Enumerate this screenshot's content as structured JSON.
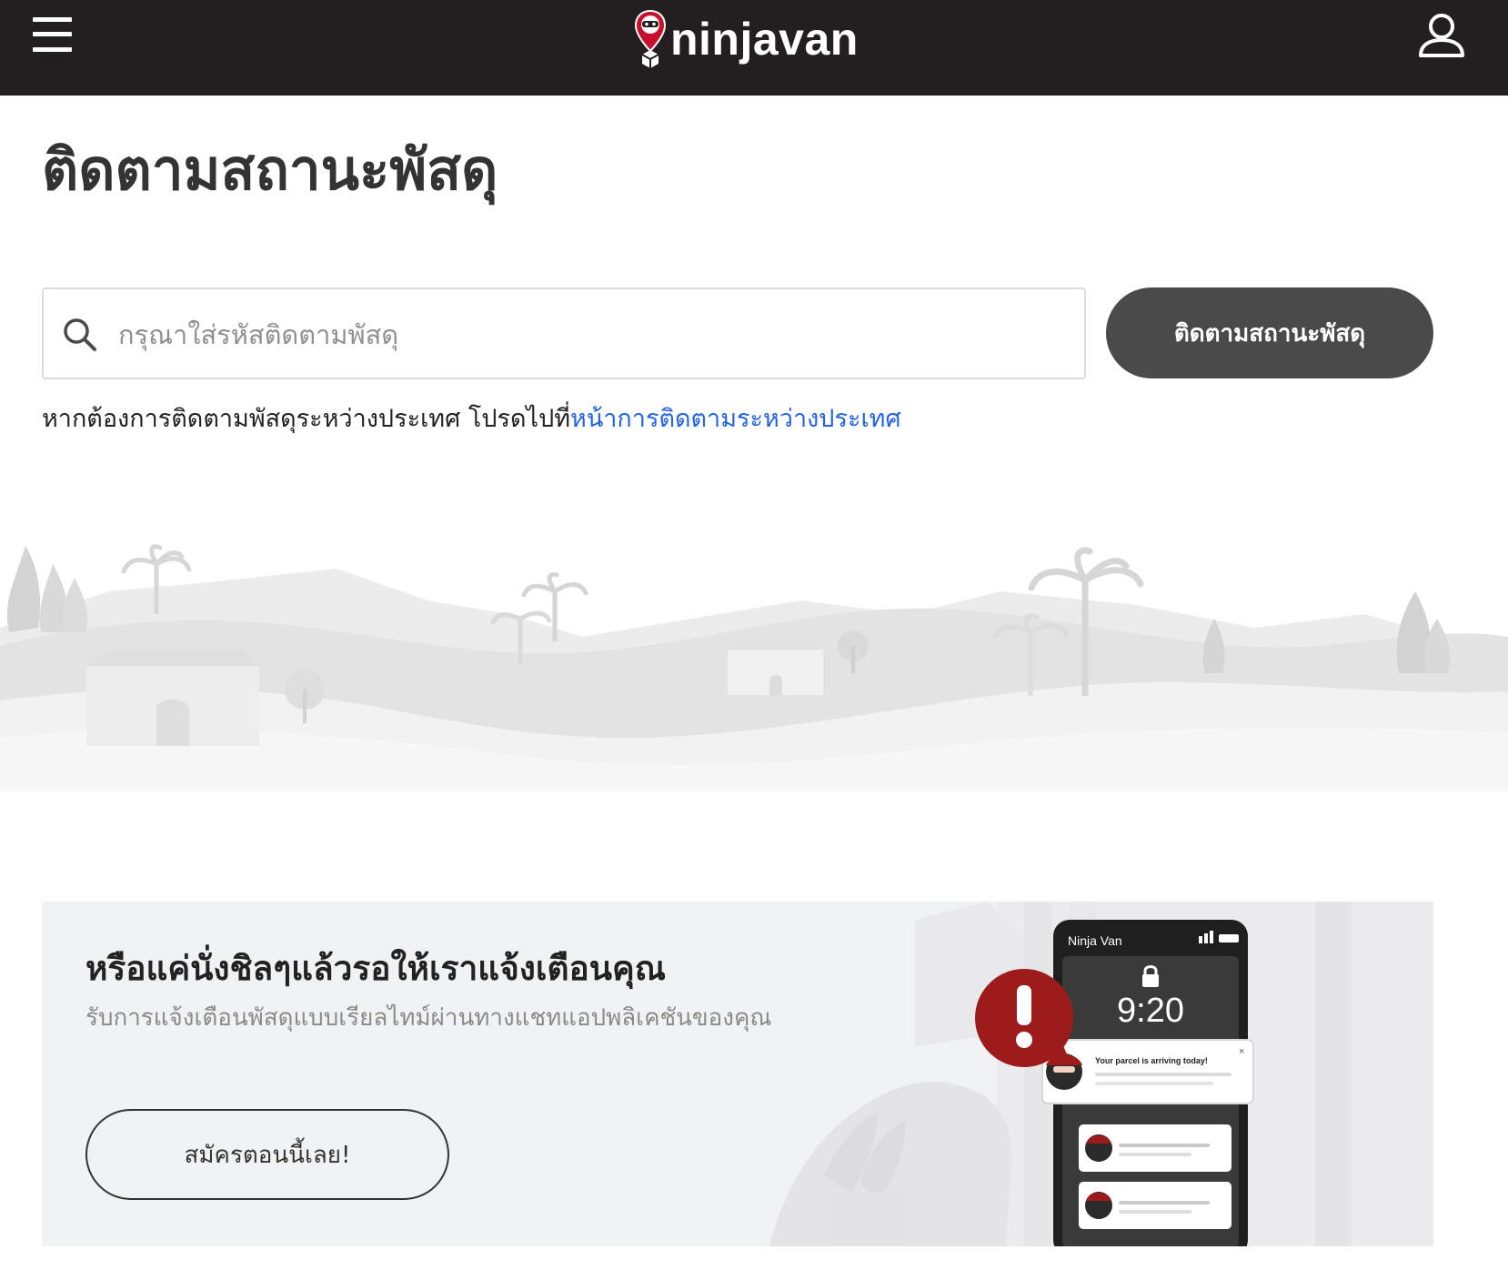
{
  "header": {
    "brand": "ninjavan",
    "menu_icon": "hamburger-menu-icon",
    "account_icon": "user-account-icon",
    "logo_icon": "ninja-map-pin-icon",
    "background_color": "#231f20"
  },
  "page": {
    "title": "ติดตามสถานะพัสดุ"
  },
  "search": {
    "placeholder": "กรุณาใส่รหัสติดตามพัสดุ",
    "value": "",
    "icon": "search-icon",
    "button_label": "ติดตามสถานะพัสดุ",
    "button_color": "#4a4a4a"
  },
  "international": {
    "prefix": "หากต้องการติดตามพัสดุระหว่างประเทศ โปรดไปที่",
    "link_text": "หน้าการติดตามระหว่างประเทศ",
    "link_color": "#2163e8"
  },
  "promo": {
    "title": "หรือแค่นั่งชิลๆแล้วรอให้เราแจ้งเตือนคุณ",
    "subtitle": "รับการแจ้งเตือนพัสดุแบบเรียลไทม์ผ่านทางแชทแอปพลิเคชันของคุณ",
    "button_label": "สมัครตอนนี้เลย!",
    "phone": {
      "app_name": "Ninja Van",
      "time": "9:20",
      "notification": "Your parcel is arriving today!"
    },
    "alert_icon": "exclamation-alert-icon",
    "lock_icon": "lock-icon",
    "accent_color": "#9e1b1b"
  }
}
